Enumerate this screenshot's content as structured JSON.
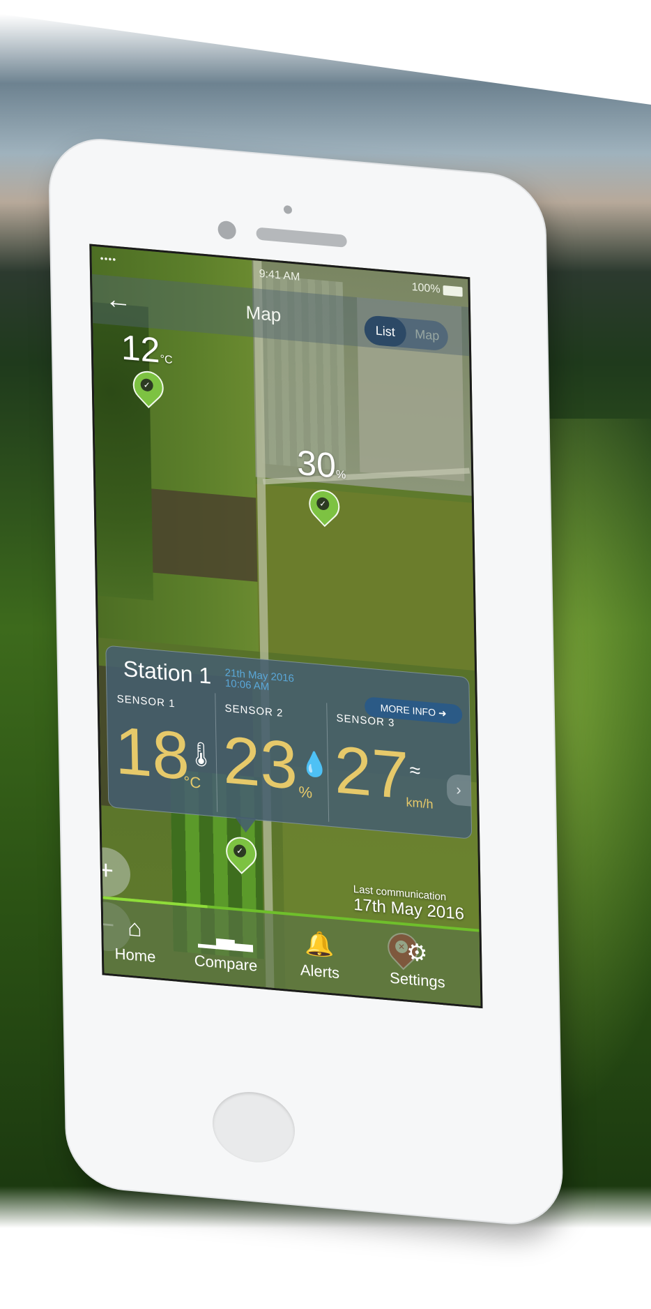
{
  "status_bar": {
    "signal": "•••• ",
    "time": "9:41 AM",
    "battery": "100%"
  },
  "nav": {
    "back_icon": "arrow-left-icon",
    "title": "Map",
    "segments": [
      "List",
      "Map"
    ],
    "selected_segment": "List"
  },
  "map_pins": [
    {
      "reading": "12",
      "unit": "°C",
      "status": "ok"
    },
    {
      "reading": "30",
      "unit": "%",
      "status": "ok"
    },
    {
      "reading": "",
      "unit": "",
      "status": "ok"
    },
    {
      "reading": "",
      "unit": "",
      "status": "error"
    }
  ],
  "station_card": {
    "title": "Station 1",
    "date": "21th May 2016",
    "time": "10:06 AM",
    "more_info_label": "MORE INFO",
    "sensors": [
      {
        "label": "SENSOR 1",
        "value": "18",
        "unit": "°C",
        "icon": "thermometer-icon"
      },
      {
        "label": "SENSOR 2",
        "value": "23",
        "unit": "%",
        "icon": "droplet-icon"
      },
      {
        "label": "SENSOR 3",
        "value": "27",
        "unit": "km/h",
        "icon": "wind-icon"
      }
    ]
  },
  "last_communication": {
    "label": "Last communication",
    "date": "17th May 2016"
  },
  "zoom": {
    "in_label": "+",
    "out_label": "−"
  },
  "tabs": [
    {
      "label": "Home",
      "icon": "home-icon"
    },
    {
      "label": "Compare",
      "icon": "bar-chart-icon"
    },
    {
      "label": "Alerts",
      "icon": "bell-icon"
    },
    {
      "label": "Settings",
      "icon": "gear-icon"
    }
  ],
  "colors": {
    "accent_green": "#7dc242",
    "alert_red": "#c0262d",
    "value_gold": "#e6c96a",
    "link_blue": "#5aa7d8"
  }
}
